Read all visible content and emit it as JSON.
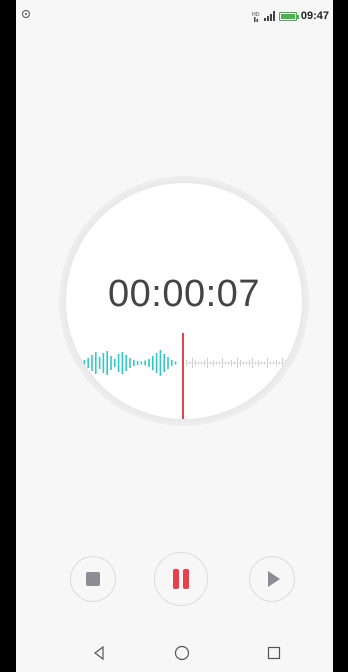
{
  "status_bar": {
    "time": "09:47",
    "icons": [
      "record-indicator-icon",
      "network-hd-icon",
      "signal-icon",
      "battery-icon"
    ],
    "battery_color": "#4caf50"
  },
  "recorder": {
    "elapsed": "00:00:07",
    "waveform_color": "#35c6c6",
    "playhead_color": "#e8414d"
  },
  "controls": {
    "stop": "stop-icon",
    "pause": "pause-icon",
    "play": "play-icon",
    "accent": "#e8414d"
  },
  "nav": [
    "back-icon",
    "home-icon",
    "recents-icon"
  ]
}
